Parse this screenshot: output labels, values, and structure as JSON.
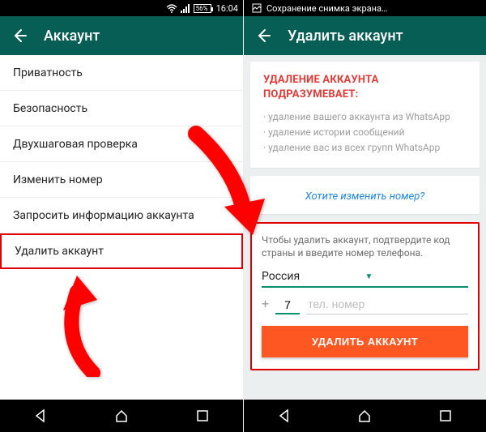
{
  "status": {
    "battery": "56%",
    "time": "16:04",
    "save_text": "Сохранение снимка экрана…"
  },
  "left": {
    "title": "Аккаунт",
    "items": [
      "Приватность",
      "Безопасность",
      "Двухшаговая проверка",
      "Изменить номер",
      "Запросить информацию аккаунта",
      "Удалить аккаунт"
    ]
  },
  "right": {
    "title": "Удалить аккаунт",
    "warn_title": "УДАЛЕНИЕ АККАУНТА ПОДРАЗУМЕВАЕТ:",
    "warn_items": [
      "удаление вашего аккаунта из WhatsApp",
      "удаление истории сообщений",
      "удаление вас из всех групп WhatsApp"
    ],
    "change_link": "Хотите изменить номер?",
    "del_intro": "Чтобы удалить аккаунт, подтвердите код страны и введите номер телефона.",
    "country": "Россия",
    "cc": "7",
    "num_placeholder": "тел. номер",
    "del_btn": "УДАЛИТЬ АККАУНТ"
  }
}
